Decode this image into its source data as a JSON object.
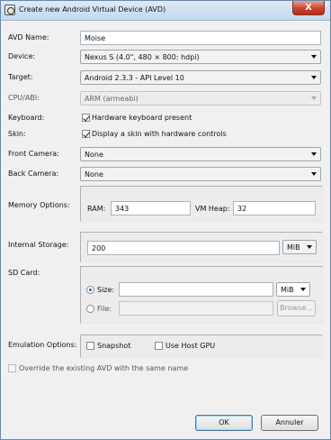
{
  "window": {
    "title": "Create new Android Virtual Device (AVD)",
    "close": "X"
  },
  "avd_name": {
    "label": "AVD Name:",
    "value": "Moise"
  },
  "device": {
    "label": "Device:",
    "value": "Nexus S (4.0\", 480 × 800: hdpi)"
  },
  "target": {
    "label": "Target:",
    "value": "Android 2.3.3 - API Level 10"
  },
  "cpu": {
    "label": "CPU/ABI:",
    "value": "ARM (armeabi)"
  },
  "keyboard": {
    "label": "Keyboard:",
    "checkbox_label": "Hardware keyboard present",
    "checked": true
  },
  "skin": {
    "label": "Skin:",
    "checkbox_label": "Display a skin with hardware controls",
    "checked": true
  },
  "front_camera": {
    "label": "Front Camera:",
    "value": "None"
  },
  "back_camera": {
    "label": "Back Camera:",
    "value": "None"
  },
  "memory": {
    "label": "Memory Options:",
    "ram_label": "RAM:",
    "ram_value": "343",
    "vm_label": "VM Heap:",
    "vm_value": "32"
  },
  "storage": {
    "label": "Internal Storage:",
    "value": "200",
    "unit": "MiB"
  },
  "sdcard": {
    "label": "SD Card:",
    "size_label": "Size:",
    "size_value": "",
    "size_unit": "MiB",
    "file_label": "File:",
    "file_value": "",
    "browse_label": "Browse..."
  },
  "emulation": {
    "label": "Emulation Options:",
    "snapshot_label": "Snapshot",
    "gpu_label": "Use Host GPU"
  },
  "override": {
    "label": "Override the existing AVD with the same name"
  },
  "buttons": {
    "ok": "OK",
    "cancel": "Annuler"
  }
}
